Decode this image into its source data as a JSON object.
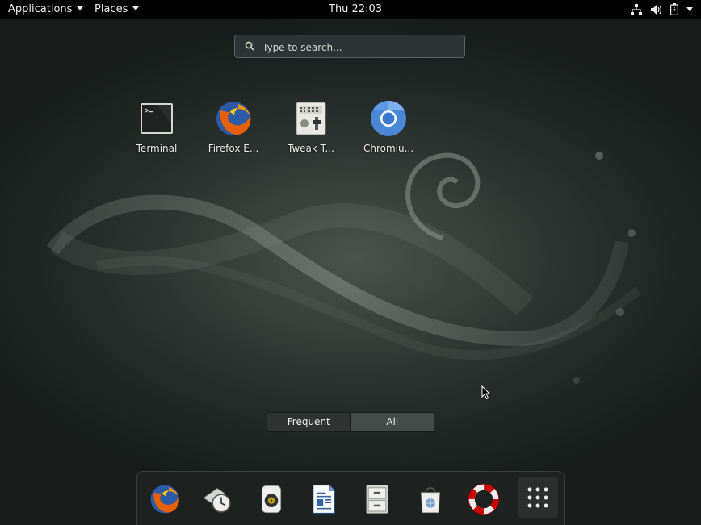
{
  "topbar": {
    "applications": "Applications",
    "places": "Places",
    "clock": "Thu 22:03",
    "status_icons": [
      "network-wired-icon",
      "volume-icon",
      "battery-charging-icon"
    ]
  },
  "search": {
    "placeholder": "Type to search..."
  },
  "apps": [
    {
      "name": "terminal",
      "label": "Terminal"
    },
    {
      "name": "firefox",
      "label": "Firefox E..."
    },
    {
      "name": "tweak-tool",
      "label": "Tweak T..."
    },
    {
      "name": "chromium",
      "label": "Chromiu..."
    }
  ],
  "view_switch": {
    "frequent": "Frequent",
    "all": "All"
  },
  "dash": {
    "items": [
      "firefox-icon",
      "clocks-icon",
      "rhythmbox-icon",
      "libreoffice-writer-icon",
      "file-manager-icon",
      "software-center-icon",
      "help-icon",
      "show-applications-icon"
    ]
  },
  "colors": {
    "topbar_bg": "#000000",
    "text": "#eeeeec",
    "search_bg": "#2e3436"
  }
}
